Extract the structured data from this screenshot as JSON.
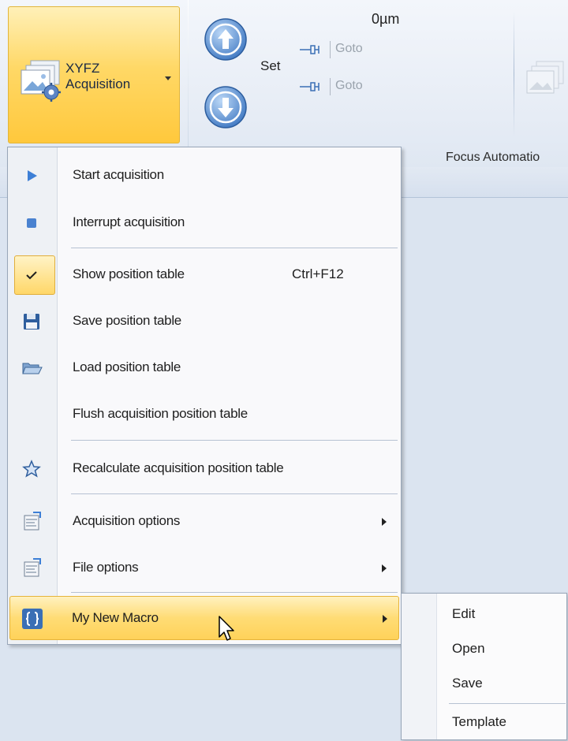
{
  "ribbon": {
    "acquisition_button": {
      "line1": "XYFZ",
      "line2": "Acquisition"
    },
    "position_value": "0µm",
    "set_label": "Set",
    "goto_top_label": "Goto",
    "goto_bottom_label": "Goto",
    "focus_group_label": "Focus Automatio"
  },
  "menu": {
    "items": [
      {
        "label": "Start acquisition",
        "icon": "play-icon"
      },
      {
        "label": "Interrupt acquisition",
        "icon": "stop-icon"
      },
      {
        "label": "Show position table",
        "shortcut": "Ctrl+F12",
        "icon": "checkmark-icon",
        "checked": true
      },
      {
        "label": "Save position table",
        "icon": "floppy-disk-icon"
      },
      {
        "label": "Load position table",
        "icon": "folder-open-icon"
      },
      {
        "label": "Flush acquisition position table",
        "icon": ""
      },
      {
        "label": "Recalculate acquisition position table",
        "icon": "star-icon"
      },
      {
        "label": "Acquisition options",
        "icon": "properties-icon",
        "has_submenu": true
      },
      {
        "label": "File options",
        "icon": "properties-icon",
        "has_submenu": true
      },
      {
        "label": "My New Macro",
        "icon": "macro-braces-icon",
        "has_submenu": true,
        "highlighted": true
      }
    ]
  },
  "submenu": {
    "items": [
      "Edit",
      "Open",
      "Save",
      "Template"
    ]
  },
  "colors": {
    "highlight": "#ffd25a",
    "highlight_border": "#e6b43a",
    "ribbon_bg": "#e6ecf5",
    "menu_bg": "#f9f9fb",
    "icon_blue": "#3d7fd6"
  }
}
